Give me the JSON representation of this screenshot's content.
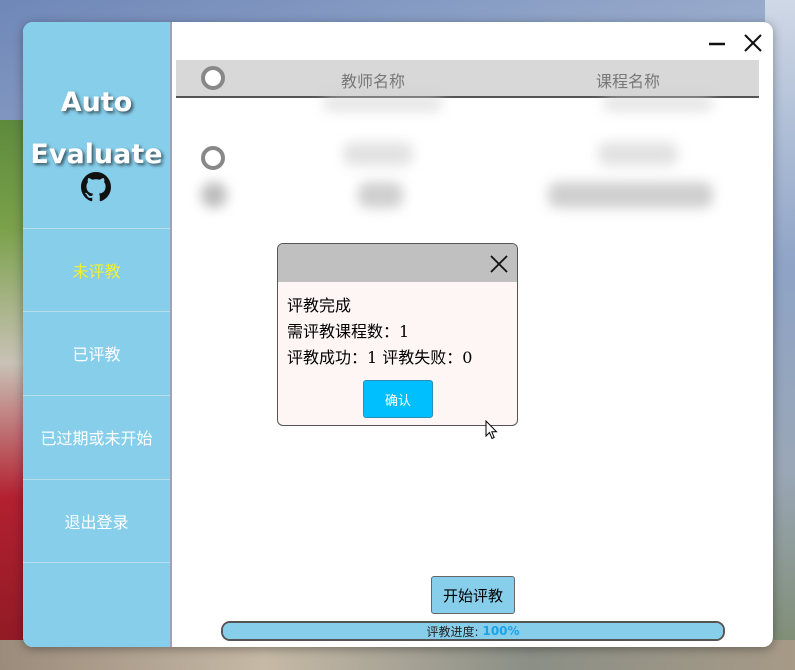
{
  "sidebar": {
    "brand_line1": "Auto",
    "brand_line2": "Evaluate",
    "items": [
      {
        "label": "未评教"
      },
      {
        "label": "已评教"
      },
      {
        "label": "已过期或未开始"
      },
      {
        "label": "退出登录"
      }
    ]
  },
  "table": {
    "columns": [
      "教师名称",
      "课程名称"
    ]
  },
  "dialog": {
    "line1": "评教完成",
    "line2": "需评教课程数：1",
    "line3": "评教成功：1 评教失败：0",
    "confirm_label": "确认"
  },
  "actions": {
    "start_label": "开始评教"
  },
  "progress": {
    "label": "评教进度:",
    "percent_text": "100%",
    "value": 1.0
  },
  "colors": {
    "sidebar": "#87ceeb",
    "active_nav": "#f0f033",
    "confirm": "#00bfff"
  }
}
